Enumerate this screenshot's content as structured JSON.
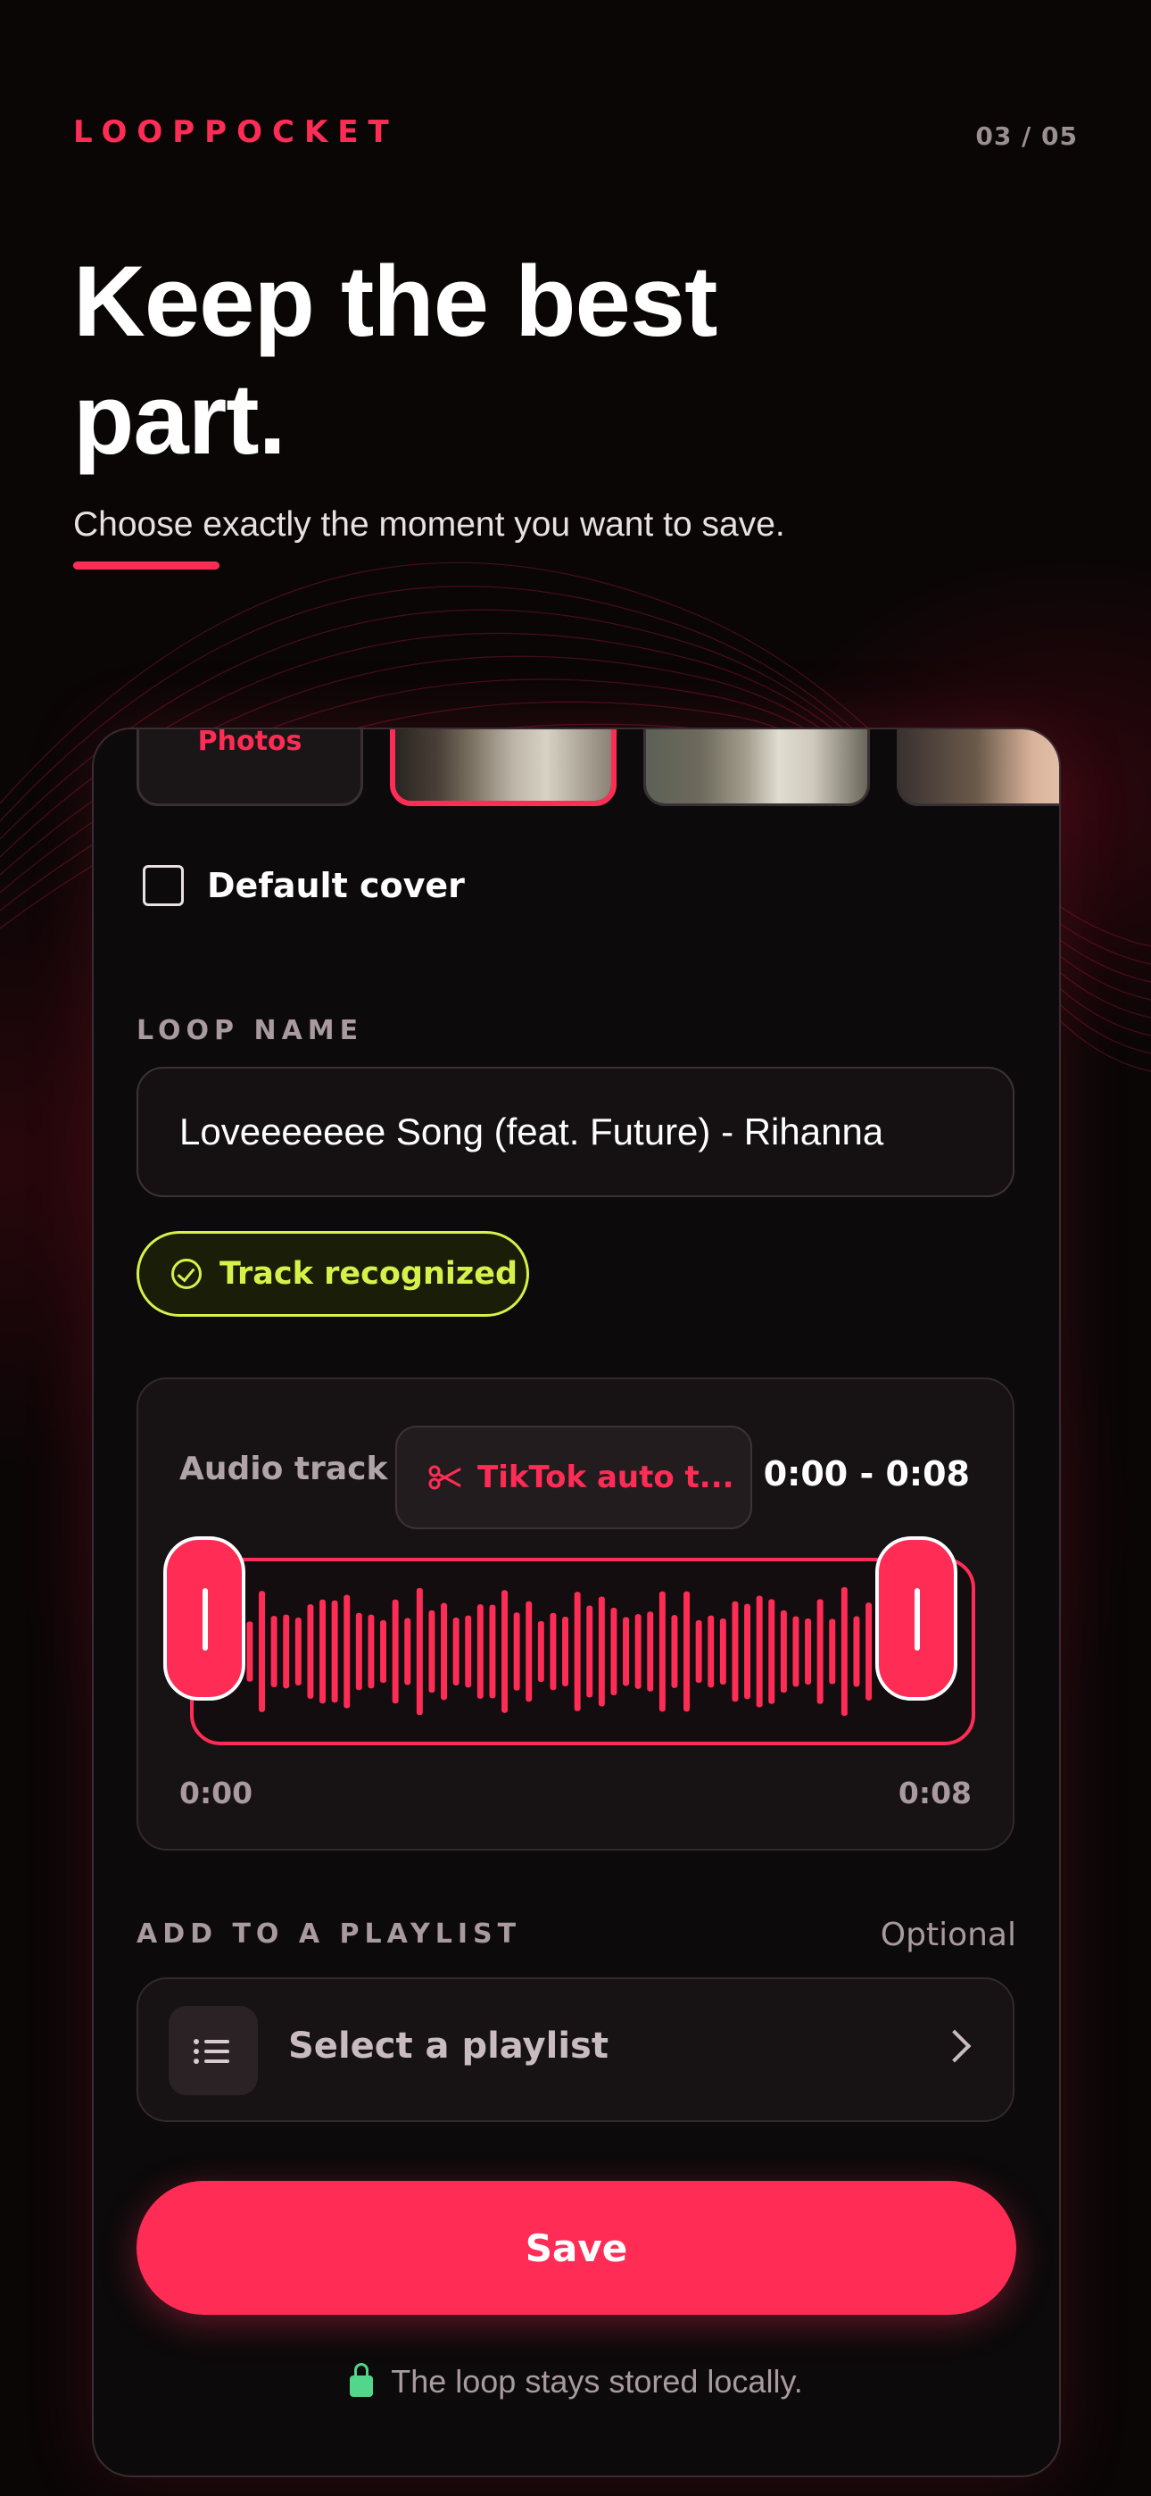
{
  "header": {
    "brand": "LOOPPOCKET",
    "pager": "03 / 05",
    "headline": "Keep the best part.",
    "subline": "Choose exactly the moment you want to save."
  },
  "cover": {
    "photos_label": "Photos",
    "default_cover_label": "Default cover",
    "default_cover_checked": false
  },
  "loop_name": {
    "label": "LOOP NAME",
    "value": "Loveeeeeee Song (feat. Future) - Rihanna",
    "recognized_label": "Track recognized"
  },
  "audio": {
    "label": "Audio track",
    "source": "TikTok auto t...",
    "range": "0:00 - 0:08",
    "start_time": "0:00",
    "end_time": "0:08",
    "accent": "#ff2d55"
  },
  "playlist": {
    "label": "ADD TO A PLAYLIST",
    "optional": "Optional",
    "placeholder": "Select a playlist"
  },
  "actions": {
    "save": "Save",
    "note": "The loop stays stored locally."
  }
}
